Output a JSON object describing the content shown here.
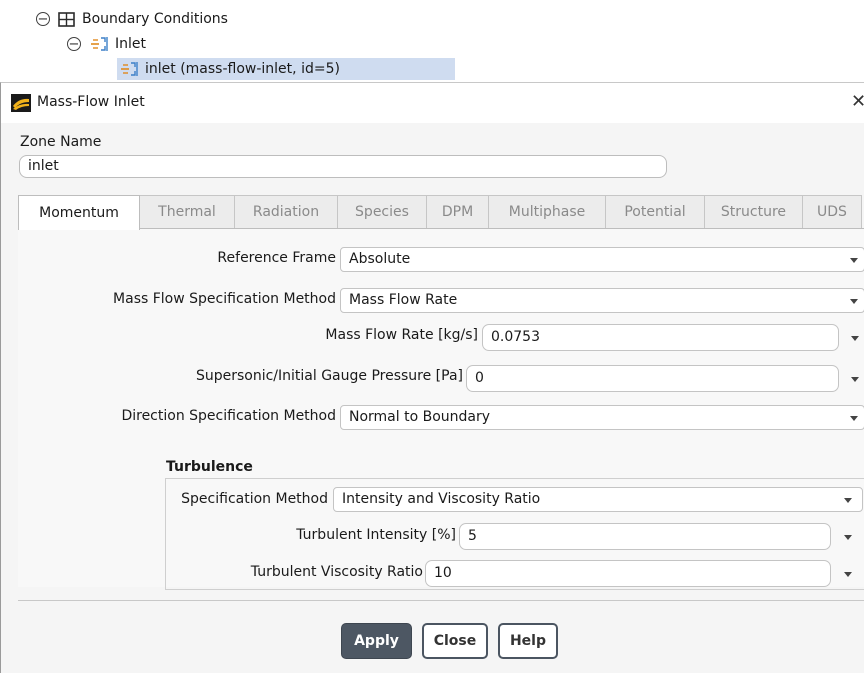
{
  "tree": {
    "root_label": "Boundary Conditions",
    "group_label": "Inlet",
    "item_label": "inlet (mass-flow-inlet, id=5)"
  },
  "dialog": {
    "title": "Mass-Flow Inlet",
    "zone_name_label": "Zone Name",
    "zone_name_value": "inlet",
    "tabs": [
      "Momentum",
      "Thermal",
      "Radiation",
      "Species",
      "DPM",
      "Multiphase",
      "Potential",
      "Structure",
      "UDS"
    ],
    "active_tab": "Momentum",
    "fields": {
      "reference_frame": {
        "label": "Reference Frame",
        "value": "Absolute"
      },
      "mass_flow_spec": {
        "label": "Mass Flow Specification Method",
        "value": "Mass Flow Rate"
      },
      "mass_flow_rate": {
        "label": "Mass Flow Rate [kg/s]",
        "value": "0.0753"
      },
      "gauge_pressure": {
        "label": "Supersonic/Initial Gauge Pressure [Pa]",
        "value": "0"
      },
      "direction_spec": {
        "label": "Direction Specification Method",
        "value": "Normal to Boundary"
      }
    },
    "turbulence": {
      "title": "Turbulence",
      "spec_method": {
        "label": "Specification Method",
        "value": "Intensity and Viscosity Ratio"
      },
      "intensity": {
        "label": "Turbulent Intensity [%]",
        "value": "5"
      },
      "viscosity_ratio": {
        "label": "Turbulent Viscosity Ratio",
        "value": "10"
      }
    },
    "buttons": {
      "apply": "Apply",
      "close": "Close",
      "help": "Help"
    }
  },
  "colors": {
    "selection": "#cfdcf0",
    "apply_button": "#4d5763",
    "dialog_bg": "#f5f5f5"
  },
  "icons": [
    "collapse-icon",
    "boundary-grid-icon",
    "inlet-icon",
    "app-logo-icon",
    "close-icon",
    "dropdown-caret-icon"
  ]
}
